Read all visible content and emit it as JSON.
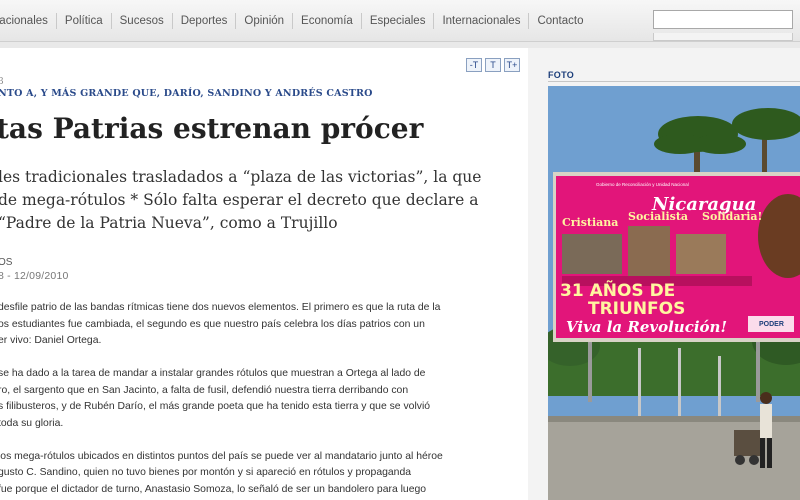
{
  "nav": {
    "items": [
      "Nacionales",
      "Política",
      "Sucesos",
      "Deportes",
      "Opinión",
      "Economía",
      "Especiales",
      "Internacionales",
      "Contacto"
    ],
    "search_placeholder": ""
  },
  "article": {
    "kicker_pre": "3",
    "kicker": "NTO A, Y MÁS GRANDE QUE, DARÍO, SANDINO Y ANDRÉS CASTRO",
    "font_buttons": [
      "-T",
      "T",
      "T+"
    ],
    "headline": "tas Patrias estrenan prócer",
    "deck": [
      "les tradicionales trasladados a “plaza de las victorias”, la que",
      "de mega-rótulos * Sólo falta esperar el decreto que declare a",
      "“Padre de la Patria Nueva”, como a Trujillo"
    ],
    "byline": "OS",
    "date": "8 - 12/09/2010",
    "paragraphs": [
      [
        "desfile patrio de las bandas rítmicas tiene dos nuevos elementos. El primero es que la ruta de la",
        "os estudiantes fue cambiada, el segundo es que nuestro país celebra los días patrios con un",
        "er vivo: Daniel Ortega."
      ],
      [
        "se ha dado a la tarea de mandar a instalar grandes rótulos que muestran a Ortega al lado de",
        "ro, el sargento que en San Jacinto, a falta de fusil, defendió nuestra tierra derribando con",
        "s filibusteros, y de Rubén Darío, el más grande poeta que ha tenido esta tierra y que se volvió",
        "toda su gloria."
      ],
      [
        "los mega-rótulos ubicados en distintos puntos del país se puede ver al mandatario junto al héroe",
        "gusto C. Sandino, quien no tuvo bienes por montón y si apareció en rótulos y propaganda",
        "fue porque el dictador de turno, Anastasio Somoza, lo señaló de ser un bandolero para luego"
      ]
    ]
  },
  "sidebar": {
    "label": "FOTO",
    "billboard": {
      "country": "Nicaragua",
      "slogan": [
        "Cristiana",
        "Socialista",
        "Solidaria!"
      ],
      "years": "31 AÑOS DE",
      "triumphs": "TRIUNFOS",
      "cheer": "Viva la Revolución!",
      "small_top": "Gobierno de Reconciliación y Unidad Nacional",
      "logo": "PODER"
    }
  }
}
